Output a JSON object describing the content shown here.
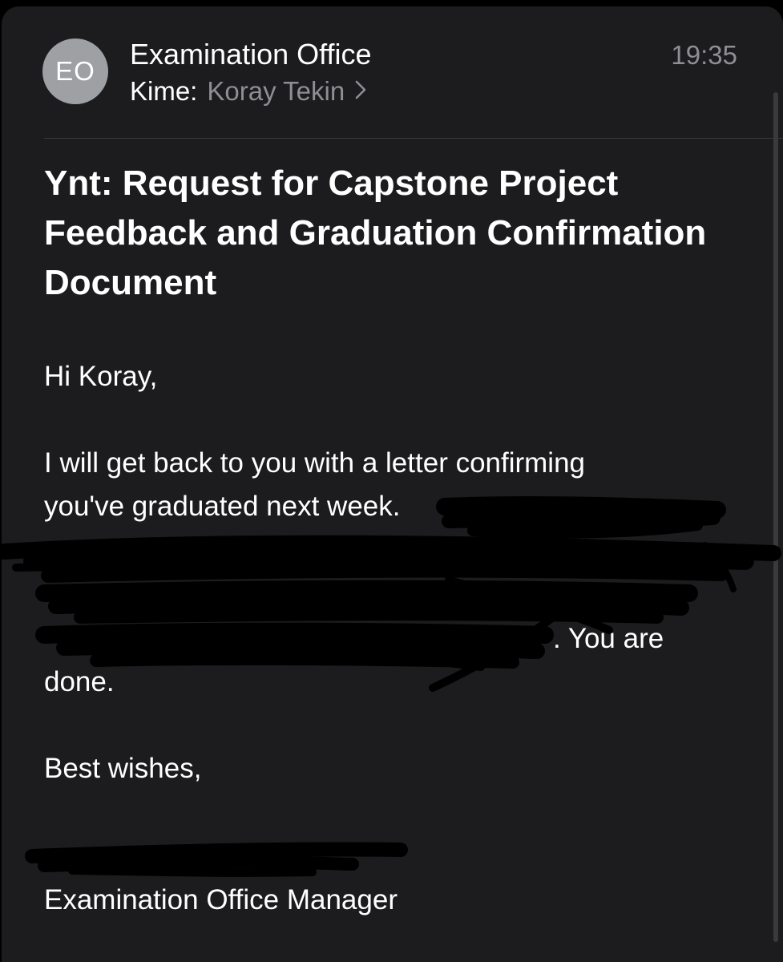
{
  "header": {
    "avatar_initials": "EO",
    "sender": "Examination Office",
    "recipient_prefix": "Kime:",
    "recipient_name": "Koray Tekin",
    "time": "19:35"
  },
  "email": {
    "subject": "Ynt: Request for Capstone Project Feedback and Graduation Confirmation Document",
    "greeting": "Hi Koray,",
    "paragraph_line1": "I will get back to you with a letter confirming",
    "paragraph_line2_visible": "you've graduated next week.",
    "paragraph_line5_visible": ". You are",
    "paragraph_line6": "done.",
    "closing": "Best wishes,",
    "signature_title": "Examination Office Manager"
  },
  "icons": {
    "recipient_chevron": "chevron-right-icon"
  },
  "colors": {
    "background": "#1c1c1e",
    "text_primary": "#ffffff",
    "text_secondary": "#8e8e93",
    "avatar": "#9fa0a4",
    "divider": "#3a3a3c"
  }
}
